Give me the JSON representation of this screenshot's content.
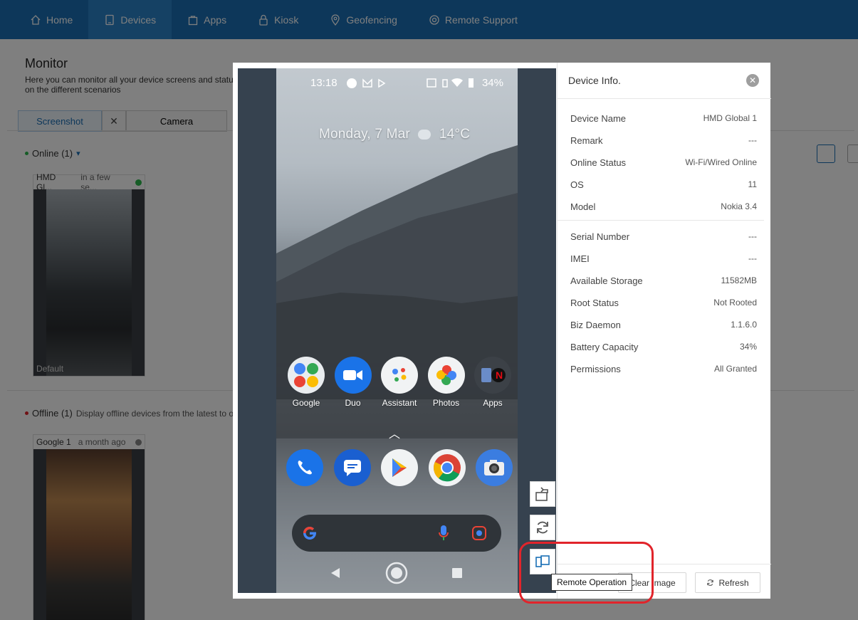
{
  "nav": {
    "items": [
      {
        "label": "Home",
        "icon": "home-icon"
      },
      {
        "label": "Devices",
        "icon": "device-icon"
      },
      {
        "label": "Apps",
        "icon": "apps-bag-icon"
      },
      {
        "label": "Kiosk",
        "icon": "lock-icon"
      },
      {
        "label": "Geofencing",
        "icon": "map-pin-icon"
      },
      {
        "label": "Remote Support",
        "icon": "support-icon"
      }
    ],
    "active": "Devices"
  },
  "monitor": {
    "title": "Monitor",
    "description": "Here you can monitor all your device screens and status on the different scenarios",
    "tabs": {
      "screenshot": "Screenshot",
      "camera": "Camera",
      "close": "✕"
    },
    "online": {
      "label": "Online (1)",
      "caret": "▾"
    },
    "offline": {
      "label": "Offline (1)",
      "desc": "Display offline devices from the latest to o"
    },
    "online_device": {
      "name": "HMD Gl...",
      "time": "in a few se...",
      "status_color": "#2db84d",
      "label": "Default"
    },
    "offline_device": {
      "name": "Google 1",
      "time": "a month ago",
      "status_color": "#888888"
    }
  },
  "phone": {
    "time": "13:18",
    "battery": "34%",
    "date": "Monday, 7 Mar",
    "temperature": "14°C",
    "apps_row": [
      "Google",
      "Duo",
      "Assistant",
      "Photos",
      "Apps"
    ],
    "dock": [
      "phone-app-icon",
      "messages-app-icon",
      "play-store-icon",
      "chrome-icon",
      "camera-app-icon"
    ],
    "chevron": "︿"
  },
  "device_info": {
    "title": "Device Info.",
    "close": "✕",
    "rows": [
      {
        "key": "Device Name",
        "value": "HMD Global 1"
      },
      {
        "key": "Remark",
        "value": "---"
      },
      {
        "key": "Online Status",
        "value": "Wi-Fi/Wired Online"
      },
      {
        "key": "OS",
        "value": "11"
      },
      {
        "key": "Model",
        "value": "Nokia 3.4"
      }
    ],
    "rows2": [
      {
        "key": "Serial Number",
        "value": "---"
      },
      {
        "key": "IMEI",
        "value": "---"
      },
      {
        "key": "Available Storage",
        "value": "11582MB"
      },
      {
        "key": "Root Status",
        "value": "Not Rooted"
      },
      {
        "key": "Biz Daemon",
        "value": "1.1.6.0"
      },
      {
        "key": "Battery Capacity",
        "value": "34%"
      },
      {
        "key": "Permissions",
        "value": "All Granted"
      }
    ],
    "clear_image": "Clear Image",
    "refresh": "Refresh"
  },
  "tooltip": "Remote Operation",
  "colors": {
    "nav_bg": "#1a6fb5",
    "accent": "#1a6fb5",
    "highlight": "#e1242b"
  }
}
